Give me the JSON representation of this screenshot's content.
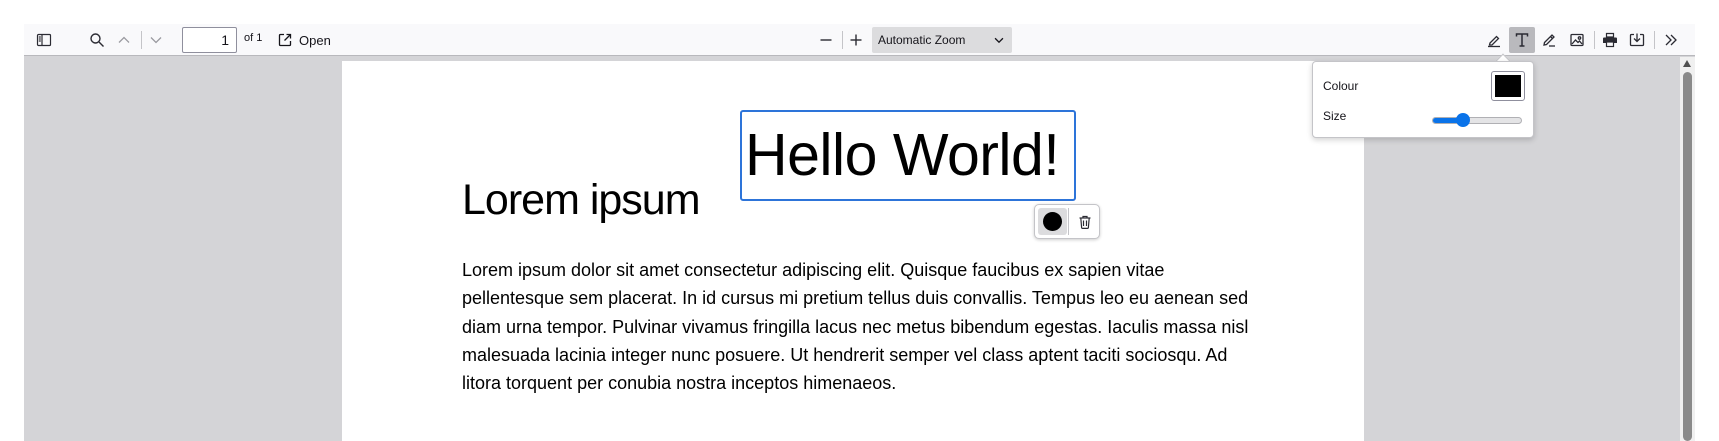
{
  "toolbar": {
    "sidebar_icon": "sidebar-toggle-icon",
    "search_icon": "search-icon",
    "previous_icon": "chevron-up-icon",
    "next_icon": "chevron-down-icon",
    "page_number": "1",
    "page_count_label": "of 1",
    "open_label": "Open",
    "zoom_out_icon": "minus-icon",
    "zoom_in_icon": "plus-icon",
    "zoom_value": "Automatic Zoom",
    "highlight_icon": "highlighter-icon",
    "free_text_icon": "text-t-icon",
    "ink_icon": "pencil-icon",
    "stamp_icon": "image-icon",
    "print_icon": "printer-icon",
    "download_icon": "download-icon",
    "more_icon": "double-chevron-right-icon"
  },
  "document": {
    "heading": "Lorem ipsum",
    "paragraph": "Lorem ipsum dolor sit amet consectetur adipiscing elit. Quisque faucibus ex sapien vitae pellentesque sem placerat. In id cursus mi pretium tellus duis convallis. Tempus leo eu aenean sed diam urna tempor. Pulvinar vivamus fringilla lacus nec metus bibendum egestas. Iaculis massa nisl malesuada lacinia integer nunc posuere. Ut hendrerit semper vel class aptent taciti sociosqu. Ad litora torquent per conubia nostra inceptos himenaeos."
  },
  "annotation": {
    "text": "Hello World!",
    "color": "#000000"
  },
  "free_text_params": {
    "colour_label": "Colour",
    "size_label": "Size",
    "colour_value": "#000000",
    "size_fraction": 0.35
  },
  "colors": {
    "selection_border": "#2d74d9",
    "accent": "#0a73e9",
    "viewer_background": "#d4d4d7",
    "toolbar_background": "#f9f9fb"
  }
}
